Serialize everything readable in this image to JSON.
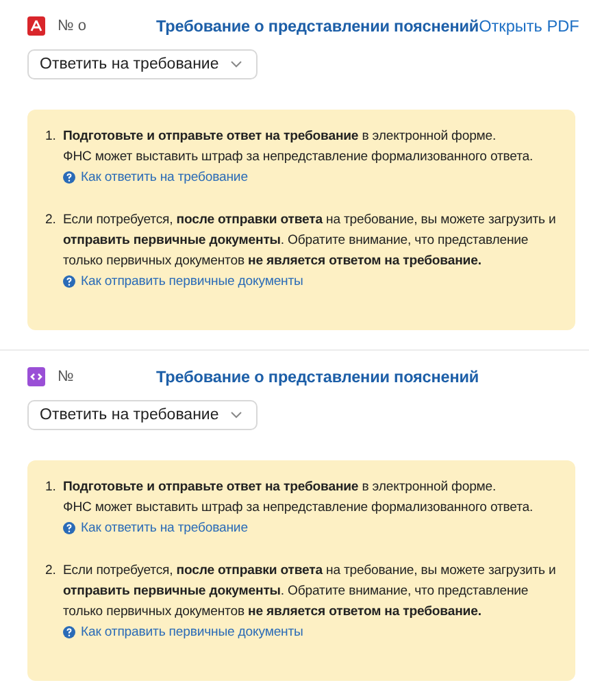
{
  "requirements": [
    {
      "kind": "pdf",
      "number": "№ о",
      "title": "Требование о представлении пояснений",
      "open_link": "Открыть PDF",
      "action": "Ответить на требование",
      "steps": [
        {
          "marker": "1.",
          "paragraphs": [
            "**Подготовьте и отправьте ответ на требование** в электронной форме.",
            "ФНС может выставить штраф за непредставление формализованного ответа."
          ],
          "help": "Как ответить на требование"
        },
        {
          "marker": "2.",
          "paragraphs": [
            "Если потребуется, **после отправки ответа** на требование, вы можете загрузить и **отправить первичные документы**. Обратите внимание, что представление только первичных документов **не является ответом на требование.**"
          ],
          "help": "Как отправить первичные документы"
        }
      ]
    },
    {
      "kind": "code",
      "number": "№",
      "title": "Требование о представлении пояснений",
      "action": "Ответить на требование",
      "steps": [
        {
          "marker": "1.",
          "paragraphs": [
            "**Подготовьте и отправьте ответ на требование** в электронной форме.",
            "ФНС может выставить штраф за непредставление формализованного ответа."
          ],
          "help": "Как ответить на требование"
        },
        {
          "marker": "2.",
          "paragraphs": [
            "Если потребуется, **после отправки ответа** на требование, вы можете загрузить и **отправить первичные документы**. Обратите внимание, что представление только первичных документов **не является ответом на требование.**"
          ],
          "help": "Как отправить первичные документы"
        }
      ]
    }
  ]
}
